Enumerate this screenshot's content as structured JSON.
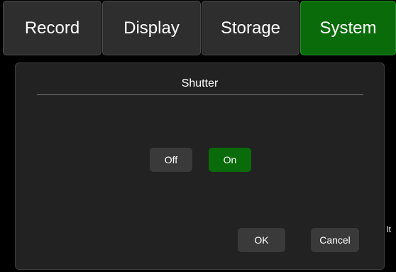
{
  "tabs": [
    {
      "label": "Record",
      "active": false
    },
    {
      "label": "Display",
      "active": false
    },
    {
      "label": "Storage",
      "active": false
    },
    {
      "label": "System",
      "active": true
    }
  ],
  "background_text": "lt",
  "dialog": {
    "title": "Shutter",
    "options": {
      "off_label": "Off",
      "on_label": "On",
      "selected": "On"
    },
    "ok_label": "OK",
    "cancel_label": "Cancel"
  },
  "colors": {
    "active_green": "#0a6b0a",
    "tab_bg": "#2e2e2e",
    "dialog_bg": "#222222",
    "button_bg": "#3a3a3a"
  }
}
